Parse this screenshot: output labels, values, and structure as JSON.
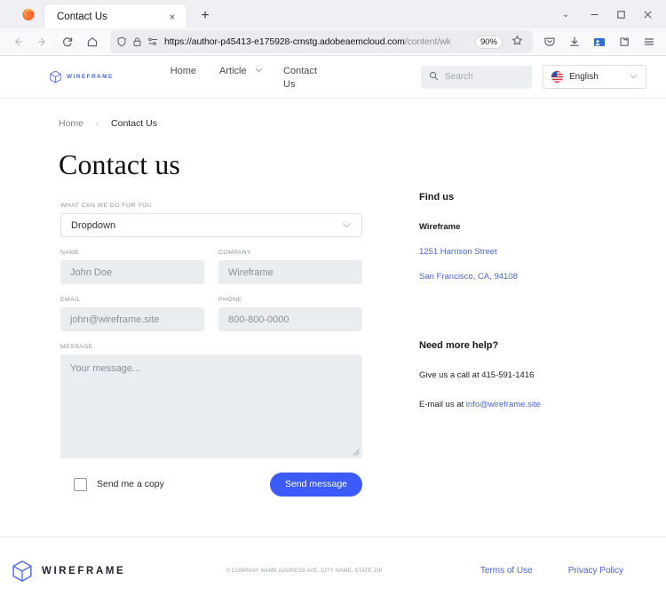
{
  "browser": {
    "app_icon": "firefox-logo-icon",
    "tab": {
      "title": "Contact Us",
      "close_label": "×"
    },
    "new_tab_label": "+",
    "tab_list_chevron": "⌄",
    "window_controls": {
      "minimize": "—",
      "maximize": "☐",
      "close": "×"
    },
    "nav": {
      "back": "←",
      "forward": "→",
      "reload": "↻",
      "home": "⌂"
    },
    "url": {
      "scheme_host": "https://author-p45413-e175928-cmstg.adobeaemcloud.com",
      "path": "/content/wk",
      "zoom_level": "90%",
      "shield_icon": "shield-icon",
      "lock_icon": "lock-icon",
      "reader_icon": "reader-view-icon",
      "bookmark_icon": "star-icon"
    },
    "toolbar_icons": [
      "pocket-icon",
      "downloads-icon",
      "account-icon",
      "extensions-icon",
      "menu-icon"
    ]
  },
  "site": {
    "brand": {
      "name": "WIREFRAME",
      "mark": "cube-logo-icon",
      "color": "#4d67e8"
    },
    "nav_items": [
      {
        "label": "Home",
        "has_chevron": false
      },
      {
        "label": "Article",
        "has_chevron": true
      },
      {
        "label": "Contact Us",
        "has_chevron": false
      }
    ],
    "search": {
      "placeholder": "Search",
      "icon": "search-icon"
    },
    "language": {
      "value": "English",
      "flag": "us-flag-icon",
      "chevron": "⌄"
    }
  },
  "breadcrumb": {
    "home": "Home",
    "separator": "›",
    "current": "Contact Us"
  },
  "page": {
    "title": "Contact us"
  },
  "form": {
    "dropdown": {
      "label": "WHAT CAN WE DO FOR YOU",
      "value": "Dropdown",
      "chevron": "⌄"
    },
    "name": {
      "label": "NAME",
      "placeholder": "John Doe"
    },
    "company": {
      "label": "COMPANY",
      "placeholder": "Wireframe"
    },
    "email": {
      "label": "EMAIL",
      "placeholder": "john@wireframe.site"
    },
    "phone": {
      "label": "PHONE",
      "placeholder": "800-800-0000"
    },
    "message": {
      "label": "MESSAGE",
      "placeholder": "Your message..."
    },
    "copy_checkbox": {
      "label": "Send me a copy",
      "checked": false
    },
    "submit": {
      "label": "Send message",
      "color": "#3b5bfd"
    }
  },
  "sidebar": {
    "find_us": {
      "heading": "Find us",
      "company": "Wireframe",
      "address_line1": "1251 Harrison Street",
      "address_line2": "San Francisco, CA, 94108"
    },
    "help": {
      "heading": "Need more help?",
      "call_text": "Give us a call at 415-591-1416",
      "email_prefix": "E-mail us at ",
      "email": "info@wireframe.site"
    }
  },
  "footer": {
    "brand": "WIREFRAME",
    "mark": "cube-logo-icon",
    "copyright": "© COMPANY NAME ADDRESS AVE, CITY NAME, STATE ZIP",
    "links": [
      {
        "label": "Terms of Use"
      },
      {
        "label": "Privacy Policy"
      }
    ]
  }
}
